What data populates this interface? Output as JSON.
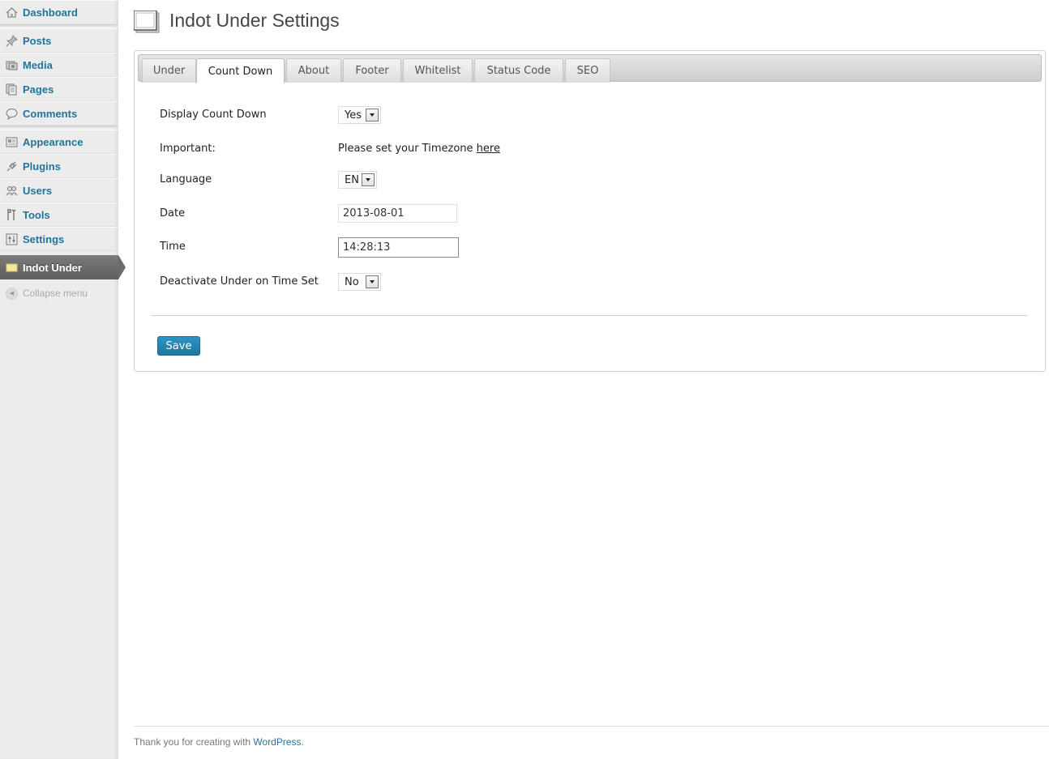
{
  "sidebar": {
    "items": [
      {
        "label": "Dashboard",
        "icon": "dashboard-icon"
      },
      {
        "label": "Posts",
        "icon": "pin-icon"
      },
      {
        "label": "Media",
        "icon": "media-icon"
      },
      {
        "label": "Pages",
        "icon": "pages-icon"
      },
      {
        "label": "Comments",
        "icon": "comment-icon"
      },
      {
        "label": "Appearance",
        "icon": "appearance-icon"
      },
      {
        "label": "Plugins",
        "icon": "plug-icon"
      },
      {
        "label": "Users",
        "icon": "users-icon"
      },
      {
        "label": "Tools",
        "icon": "tools-icon"
      },
      {
        "label": "Settings",
        "icon": "settings-icon"
      },
      {
        "label": "Indot Under",
        "icon": "folder-icon",
        "current": true
      }
    ],
    "collapse_label": "Collapse menu"
  },
  "page": {
    "title": "Indot Under Settings"
  },
  "tabs": [
    {
      "label": "Under"
    },
    {
      "label": "Count Down",
      "active": true
    },
    {
      "label": "About"
    },
    {
      "label": "Footer"
    },
    {
      "label": "Whitelist"
    },
    {
      "label": "Status Code"
    },
    {
      "label": "SEO"
    }
  ],
  "form": {
    "display_countdown": {
      "label": "Display Count Down",
      "value": "Yes"
    },
    "important": {
      "label": "Important:",
      "text": "Please set your Timezone ",
      "link": "here"
    },
    "language": {
      "label": "Language",
      "value": "EN"
    },
    "date": {
      "label": "Date",
      "value": "2013-08-01"
    },
    "time": {
      "label": "Time",
      "value": "14:28:13"
    },
    "deactivate": {
      "label": "Deactivate Under on Time Set",
      "value": "No"
    },
    "save_label": "Save"
  },
  "footer": {
    "text": "Thank you for creating with ",
    "link": "WordPress",
    "suffix": "."
  },
  "colors": {
    "link": "#21759b",
    "button": "#21759b",
    "current_menu": "#6a6a6a"
  }
}
